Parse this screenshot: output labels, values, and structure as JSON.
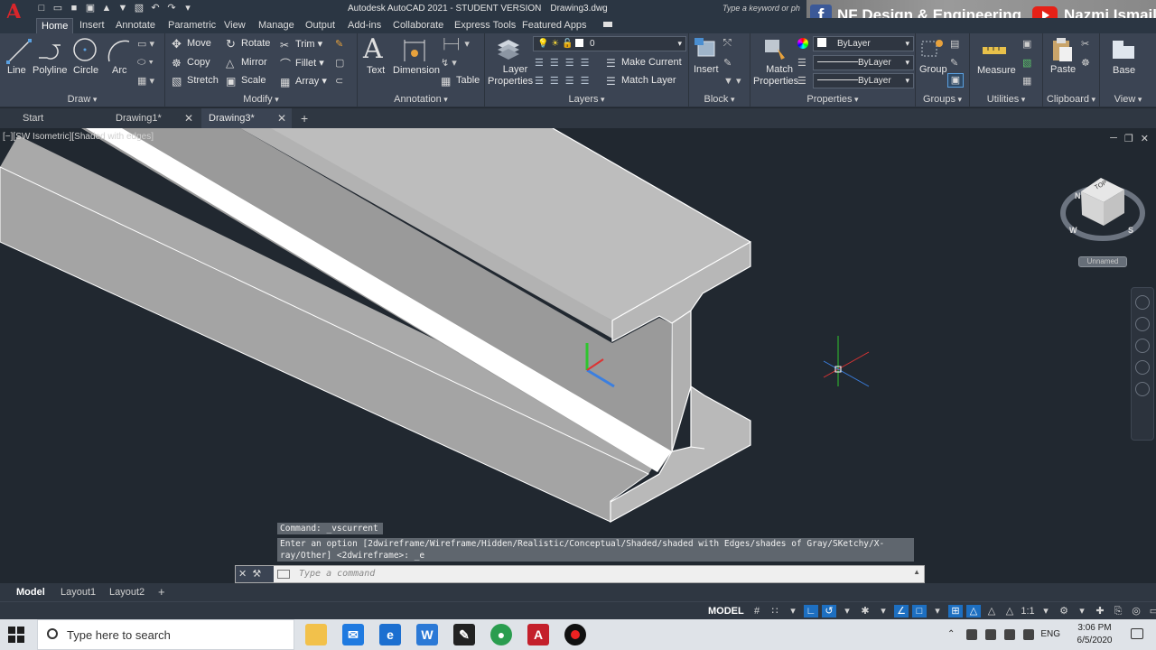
{
  "titlebar": {
    "app_name": "Autodesk AutoCAD 2021 - STUDENT VERSION",
    "file_name": "Drawing3.dwg",
    "search_placeholder": "Type a keyword or ph"
  },
  "social_banner": {
    "facebook": "NF Design & Engineering",
    "youtube": "Nazmi Ismail"
  },
  "ribbon_tabs": [
    "Home",
    "Insert",
    "Annotate",
    "Parametric",
    "View",
    "Manage",
    "Output",
    "Add-ins",
    "Collaborate",
    "Express Tools",
    "Featured Apps"
  ],
  "ribbon": {
    "draw": {
      "title": "Draw",
      "line": "Line",
      "polyline": "Polyline",
      "circle": "Circle",
      "arc": "Arc"
    },
    "modify": {
      "title": "Modify",
      "move": "Move",
      "rotate": "Rotate",
      "trim": "Trim",
      "copy": "Copy",
      "mirror": "Mirror",
      "fillet": "Fillet",
      "stretch": "Stretch",
      "scale": "Scale",
      "array": "Array"
    },
    "annotation": {
      "title": "Annotation",
      "text": "Text",
      "dimension": "Dimension",
      "table": "Table"
    },
    "layers": {
      "title": "Layers",
      "layer_properties_1": "Layer",
      "layer_properties_2": "Properties",
      "current_layer": "0",
      "make_current": "Make Current",
      "match_layer": "Match Layer"
    },
    "block": {
      "title": "Block",
      "insert": "Insert"
    },
    "properties": {
      "title": "Properties",
      "match_1": "Match",
      "match_2": "Properties",
      "color": "ByLayer",
      "linetype": "ByLayer",
      "lineweight": "ByLayer"
    },
    "groups": {
      "title": "Groups",
      "group": "Group"
    },
    "utilities": {
      "title": "Utilities",
      "measure": "Measure"
    },
    "clipboard": {
      "title": "Clipboard",
      "paste": "Paste"
    },
    "view": {
      "title": "View",
      "base": "Base"
    }
  },
  "file_tabs": [
    {
      "label": "Start"
    },
    {
      "label": "Drawing1*"
    },
    {
      "label": "Drawing3*"
    }
  ],
  "viewport": {
    "label": "[−][SW Isometric][Shaded with edges]",
    "viewcube_unnamed": "Unnamed",
    "viewcube_faces": {
      "top": "TOP",
      "front": "FRONT",
      "left": "LEFT"
    },
    "compass": {
      "n": "N",
      "s": "S",
      "w": "W"
    }
  },
  "command": {
    "history_1": "Command: _vscurrent",
    "history_2": "Enter an option [2dwireframe/Wireframe/Hidden/Realistic/Conceptual/Shaded/shaded with Edges/shades of Gray/SKetchy/X-",
    "history_3": "ray/Other] <2dwireframe>: _e",
    "placeholder": "Type a command"
  },
  "layout_tabs": [
    "Model",
    "Layout1",
    "Layout2"
  ],
  "statusbar": {
    "model": "MODEL",
    "scale": "1:1"
  },
  "taskbar": {
    "search": "Type here to search",
    "lang": "ENG",
    "time": "3:06 PM",
    "date": "6/5/2020"
  },
  "colors": {
    "background": "#212830",
    "ribbon": "#3b4453",
    "beam_top": "#bdbdbd",
    "beam_side": "#a4a4a4",
    "beam_highlight": "#ffffff",
    "accent": "#1d6fc1"
  }
}
